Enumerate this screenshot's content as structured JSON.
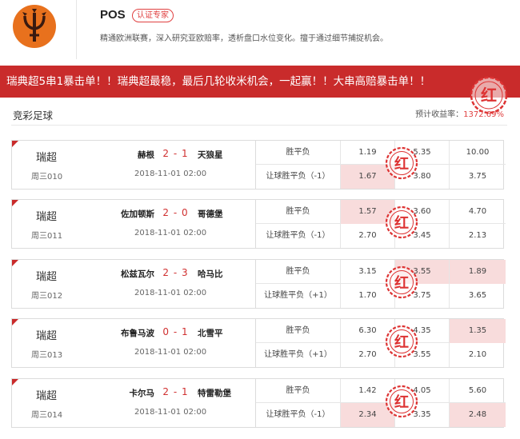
{
  "profile": {
    "name": "POS",
    "badge": "认证专家",
    "description": "精通欧洲联赛，深入研究亚欧赔率，透析盘口水位变化。擅于通过细节捕捉机会。"
  },
  "banner": {
    "text": "瑞典超5串1暴击单！！瑞典超最稳，最后几轮收米机会，一起赢！！大串高赔暴击单！！"
  },
  "section": {
    "title": "竞彩足球",
    "yield_label": "预计收益率：",
    "yield_value": "1372.69%"
  },
  "stamp_char": "红",
  "colors": {
    "accent": "#c92b2b",
    "highlight": "#f8dcdc",
    "score": "#d03030"
  },
  "matches": [
    {
      "league": "瑞超",
      "code": "周三010",
      "home": "赫根",
      "score": "2 - 1",
      "away": "天狼星",
      "time": "2018-11-01 02:00",
      "row1": {
        "label": "胜平负",
        "odds": [
          "1.19",
          "5.35",
          "10.00"
        ],
        "highlight": []
      },
      "row2": {
        "label": "让球胜平负（-1）",
        "odds": [
          "1.67",
          "3.80",
          "3.75"
        ],
        "highlight": [
          0
        ]
      }
    },
    {
      "league": "瑞超",
      "code": "周三011",
      "home": "佐加顿斯",
      "score": "2 - 0",
      "away": "哥德堡",
      "time": "2018-11-01 02:00",
      "row1": {
        "label": "胜平负",
        "odds": [
          "1.57",
          "3.60",
          "4.70"
        ],
        "highlight": [
          0
        ]
      },
      "row2": {
        "label": "让球胜平负（-1）",
        "odds": [
          "2.70",
          "3.45",
          "2.13"
        ],
        "highlight": []
      }
    },
    {
      "league": "瑞超",
      "code": "周三012",
      "home": "松兹瓦尔",
      "score": "2 - 3",
      "away": "哈马比",
      "time": "2018-11-01 02:00",
      "row1": {
        "label": "胜平负",
        "odds": [
          "3.15",
          "3.55",
          "1.89"
        ],
        "highlight": [
          1,
          2
        ]
      },
      "row2": {
        "label": "让球胜平负（+1）",
        "odds": [
          "1.70",
          "3.75",
          "3.65"
        ],
        "highlight": []
      }
    },
    {
      "league": "瑞超",
      "code": "周三013",
      "home": "布鲁马波",
      "score": "0 - 1",
      "away": "北雪平",
      "time": "2018-11-01 02:00",
      "row1": {
        "label": "胜平负",
        "odds": [
          "6.30",
          "4.35",
          "1.35"
        ],
        "highlight": [
          2
        ]
      },
      "row2": {
        "label": "让球胜平负（+1）",
        "odds": [
          "2.70",
          "3.55",
          "2.10"
        ],
        "highlight": []
      }
    },
    {
      "league": "瑞超",
      "code": "周三014",
      "home": "卡尔马",
      "score": "2 - 1",
      "away": "特雷勒堡",
      "time": "2018-11-01 02:00",
      "row1": {
        "label": "胜平负",
        "odds": [
          "1.42",
          "4.05",
          "5.60"
        ],
        "highlight": []
      },
      "row2": {
        "label": "让球胜平负（-1）",
        "odds": [
          "2.34",
          "3.35",
          "2.48"
        ],
        "highlight": [
          0,
          2
        ]
      }
    }
  ]
}
